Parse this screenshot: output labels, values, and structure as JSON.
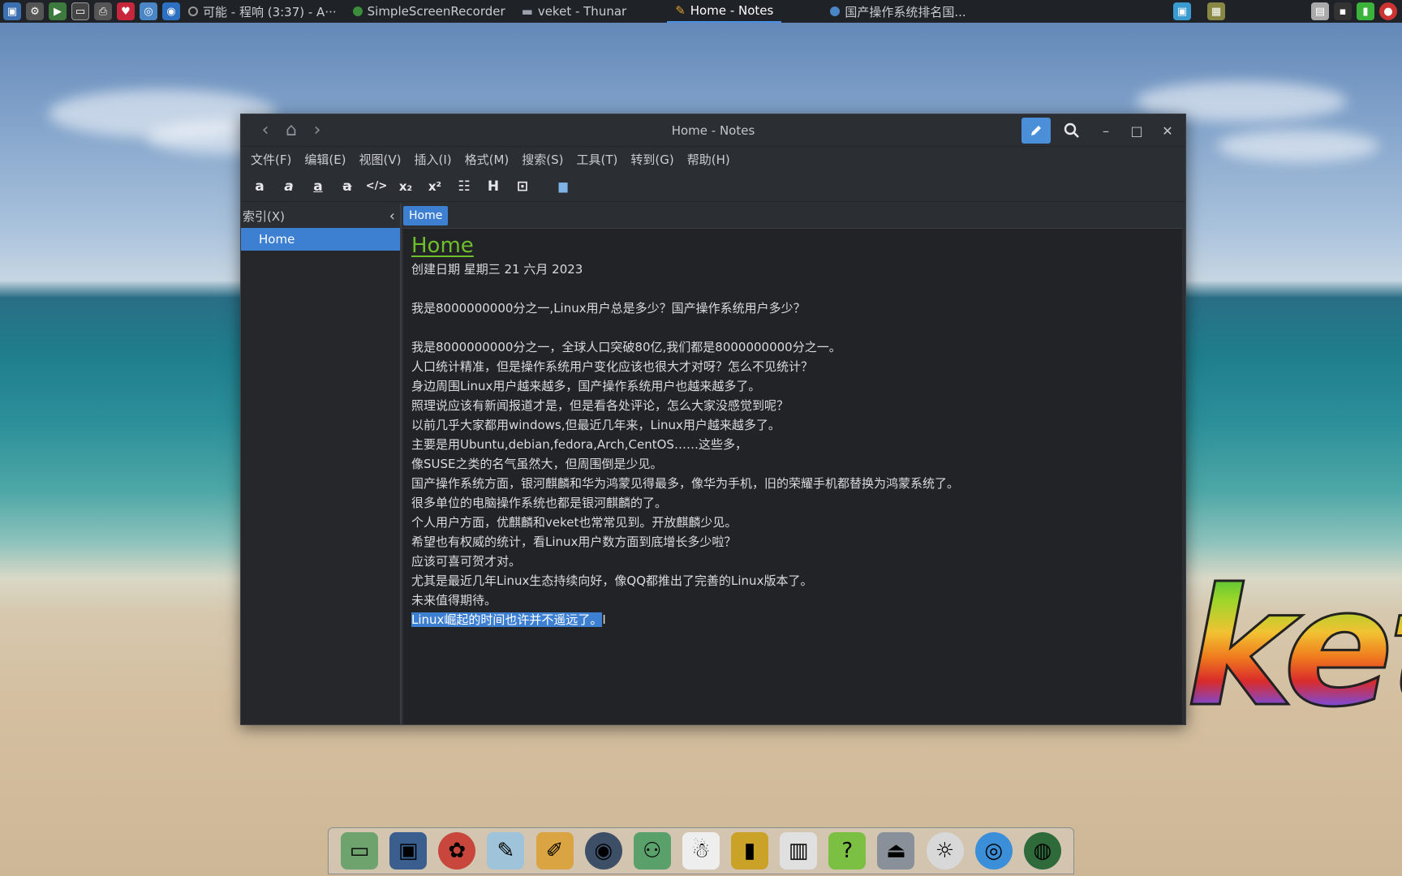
{
  "taskbar": {
    "tasks": [
      {
        "label": "可能 - 程响 (3:37) - A···",
        "icon": "music-icon"
      },
      {
        "label": "SimpleScreenRecorder",
        "icon": "recorder-icon"
      },
      {
        "label": "veket - Thunar",
        "icon": "folder-icon"
      },
      {
        "label": "Home - Notes",
        "icon": "notes-icon",
        "active": true
      },
      {
        "label": "国产操作系统排名国...",
        "icon": "browser-icon"
      }
    ]
  },
  "window": {
    "title": "Home - Notes",
    "menu": [
      "文件(F)",
      "编辑(E)",
      "视图(V)",
      "插入(I)",
      "格式(M)",
      "搜索(S)",
      "工具(T)",
      "转到(G)",
      "帮助(H)"
    ],
    "sidebar": {
      "title": "索引(X)",
      "items": [
        "Home"
      ]
    },
    "pathbar": {
      "current": "Home"
    },
    "page": {
      "heading": "Home",
      "created": "创建日期 星期三 21 六月 2023",
      "question": "我是8000000000分之一,Linux用户总是多少？国产操作系统用户多少？",
      "lines": [
        "我是8000000000分之一，全球人口突破80亿,我们都是8000000000分之一。",
        "人口统计精准，但是操作系统用户变化应该也很大才对呀？怎么不见统计？",
        "身边周围Linux用户越来越多，国产操作系统用户也越来越多了。",
        "照理说应该有新闻报道才是，但是看各处评论，怎么大家没感觉到呢？",
        "以前几乎大家都用windows,但最近几年来，Linux用户越来越多了。",
        "主要是用Ubuntu,debian,fedora,Arch,CentOS……这些多，",
        "像SUSE之类的名气虽然大，但周围倒是少见。",
        "国产操作系统方面，银河麒麟和华为鸿蒙见得最多，像华为手机，旧的荣耀手机都替换为鸿蒙系统了。",
        "很多单位的电脑操作系统也都是银河麒麟的了。",
        "个人用户方面，优麒麟和veket也常常见到。开放麒麟少见。",
        "希望也有权威的统计，看Linux用户数方面到底增长多少啦？",
        "应该可喜可贺才对。",
        "尤其是最近几年Linux生态持续向好，像QQ都推出了完善的Linux版本了。",
        "未来值得期待。"
      ],
      "selected_line": "Linux崛起的时间也许并不遥远了。"
    }
  },
  "desktop": {
    "logo_text": "ket"
  }
}
